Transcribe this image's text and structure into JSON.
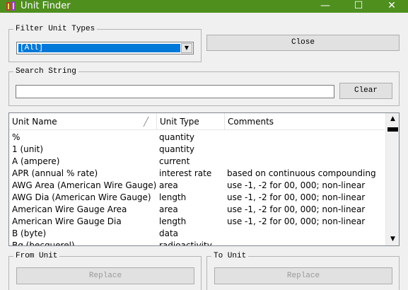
{
  "window": {
    "title": "Unit Finder",
    "controls": {
      "minimize": "—",
      "maximize": "☐",
      "close": "✕"
    },
    "title_bar_color": "#4f8f1e"
  },
  "filter": {
    "legend": "Filter Unit Types",
    "selected": "[All]"
  },
  "close_label": "Close",
  "search": {
    "legend": "Search String",
    "value": "",
    "clear_label": "Clear"
  },
  "table": {
    "headers": {
      "name": "Unit Name",
      "type": "Unit Type",
      "comments": "Comments"
    },
    "rows": [
      {
        "name": "%",
        "type": "quantity",
        "comments": ""
      },
      {
        "name": "1  (unit)",
        "type": "quantity",
        "comments": ""
      },
      {
        "name": "A  (ampere)",
        "type": "current",
        "comments": ""
      },
      {
        "name": "APR  (annual % rate)",
        "type": "interest rate",
        "comments": "based on continuous compounding"
      },
      {
        "name": "AWG Area  (American Wire Gauge)",
        "type": "area",
        "comments": "use -1, -2 for 00, 000; non-linear"
      },
      {
        "name": "AWG Dia  (American Wire Gauge)",
        "type": "length",
        "comments": "use -1, -2 for 00, 000; non-linear"
      },
      {
        "name": "American Wire Gauge Area",
        "type": "area",
        "comments": "use -1, -2 for 00, 000; non-linear"
      },
      {
        "name": "American Wire Gauge Dia",
        "type": "length",
        "comments": "use -1, -2 for 00, 000; non-linear"
      },
      {
        "name": "B  (byte)",
        "type": "data",
        "comments": ""
      },
      {
        "name": "Bq  (becquerel)",
        "type": "radioactivity",
        "comments": ""
      }
    ]
  },
  "from_unit": {
    "legend": "From Unit",
    "replace_label": "Replace"
  },
  "to_unit": {
    "legend": "To Unit",
    "replace_label": "Replace"
  }
}
